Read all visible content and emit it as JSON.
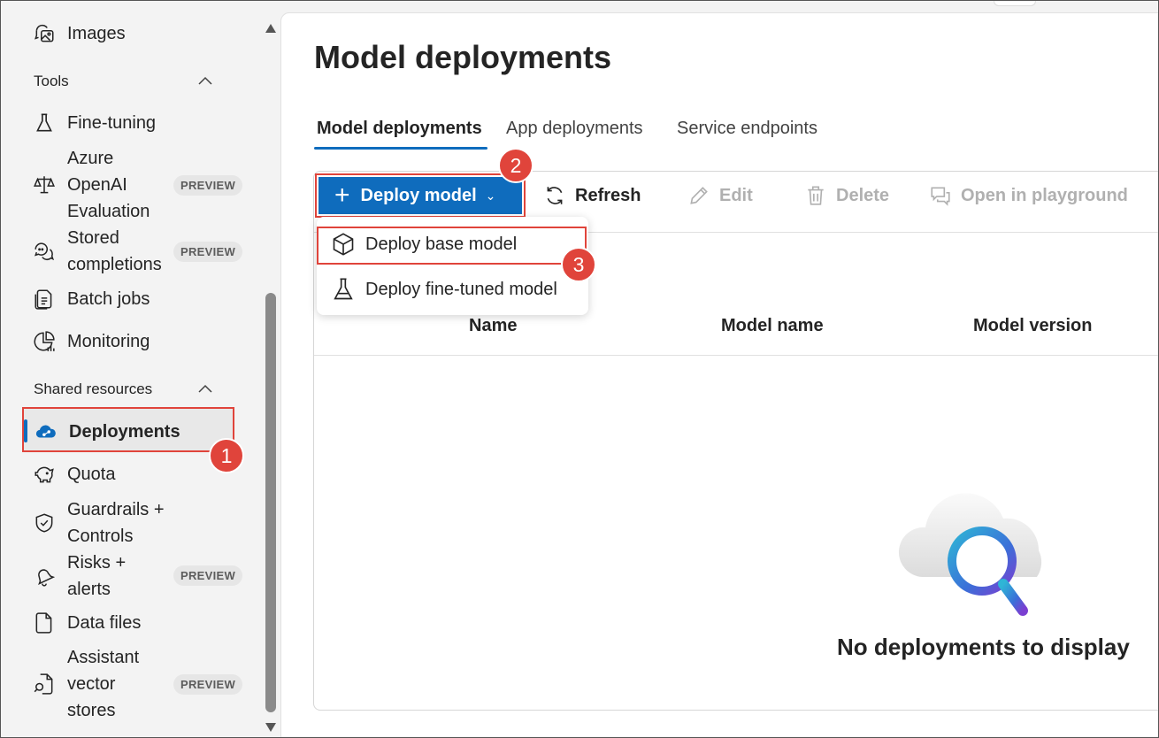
{
  "sidebar": {
    "items_top": [
      {
        "label": "Images",
        "icon": "image-chat-icon"
      }
    ],
    "tools_section": "Tools",
    "tools": [
      {
        "label": "Fine-tuning",
        "icon": "flask-icon"
      },
      {
        "label": "Azure OpenAI Evaluation",
        "lines": [
          "Azure",
          "OpenAI",
          "Evaluation"
        ],
        "badge": "PREVIEW",
        "icon": "scales-icon"
      },
      {
        "label": "Stored completions",
        "lines": [
          "Stored",
          "completions"
        ],
        "badge": "PREVIEW",
        "icon": "chat-multiple-icon"
      },
      {
        "label": "Batch jobs",
        "icon": "document-batch-icon"
      },
      {
        "label": "Monitoring",
        "icon": "chart-pie-icon"
      }
    ],
    "shared_section": "Shared resources",
    "shared": [
      {
        "label": "Deployments",
        "icon": "cloud-deploy-icon",
        "selected": true
      },
      {
        "label": "Quota",
        "icon": "piggy-bank-icon"
      },
      {
        "label": "Guardrails + Controls",
        "lines": [
          "Guardrails +",
          "Controls"
        ],
        "icon": "shield-check-icon"
      },
      {
        "label": "Risks + alerts",
        "lines": [
          "Risks +",
          "alerts"
        ],
        "badge": "PREVIEW",
        "icon": "alert-bell-icon"
      },
      {
        "label": "Data files",
        "icon": "document-icon"
      },
      {
        "label": "Assistant vector stores",
        "lines": [
          "Assistant",
          "vector",
          "stores"
        ],
        "badge": "PREVIEW",
        "icon": "document-search-icon"
      }
    ]
  },
  "callouts": [
    "1",
    "2",
    "3"
  ],
  "main": {
    "title": "Model deployments",
    "tabs": [
      "Model deployments",
      "App deployments",
      "Service endpoints"
    ],
    "toolbar": {
      "deploy": "Deploy model",
      "refresh": "Refresh",
      "edit": "Edit",
      "delete": "Delete",
      "playground": "Open in playground"
    },
    "menu": [
      "Deploy base model",
      "Deploy fine-tuned model"
    ],
    "columns": [
      "Name",
      "Model name",
      "Model version"
    ],
    "empty_message": "No deployments to display"
  },
  "colors": {
    "accent": "#0f6cbd",
    "highlight": "#e0443b"
  }
}
